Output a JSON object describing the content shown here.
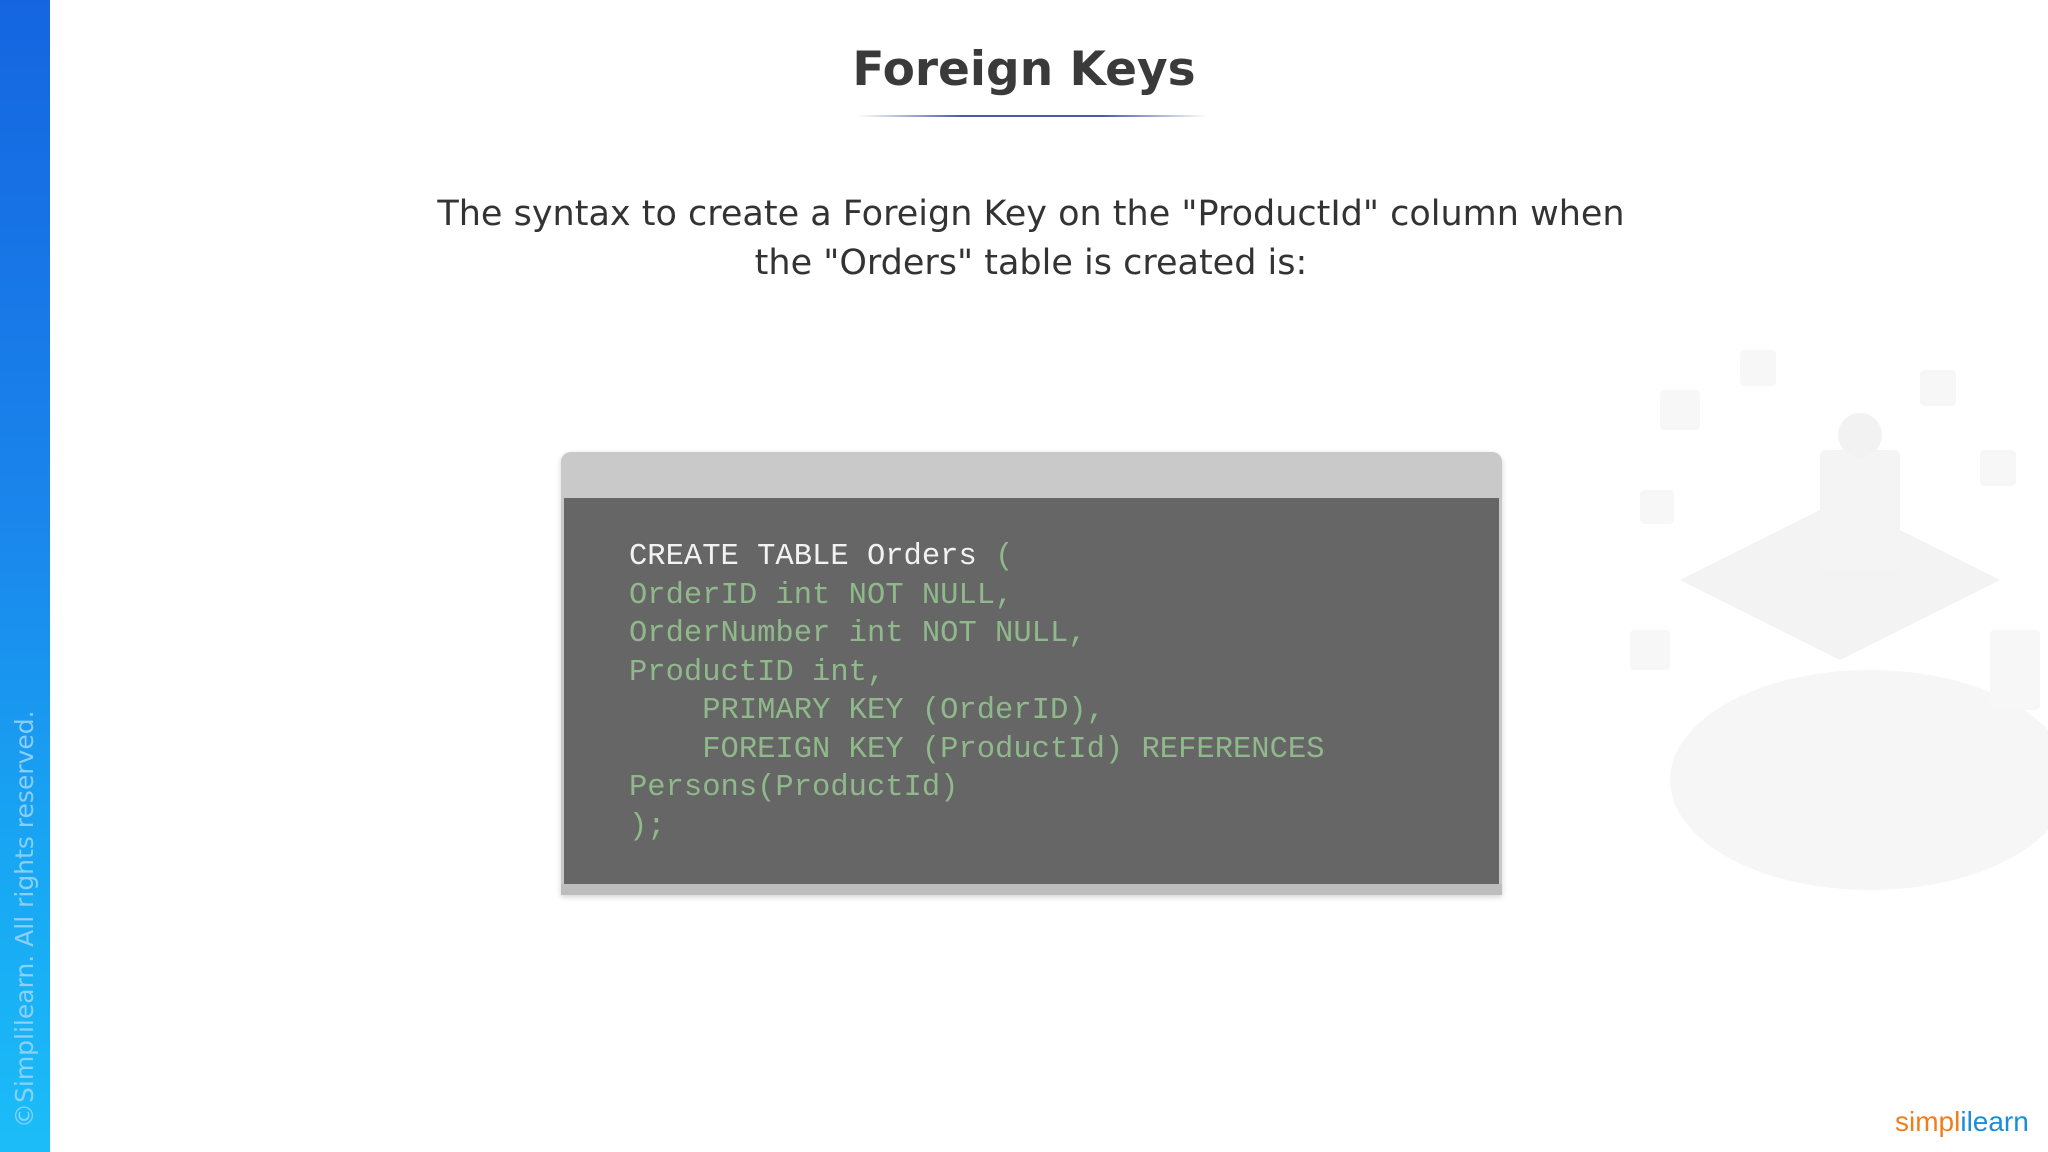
{
  "slide": {
    "title": "Foreign Keys",
    "intro": "The syntax to create a Foreign Key on the \"ProductId\" column when the \"Orders\" table is created is:"
  },
  "code": {
    "first_line_keyword": "CREATE TABLE Orders",
    "first_line_rest": " (",
    "lines": [
      "OrderID int NOT NULL,",
      "OrderNumber int NOT NULL,",
      "ProductID int,",
      "    PRIMARY KEY (OrderID),",
      "    FOREIGN KEY (ProductId) REFERENCES",
      "Persons(ProductId)",
      ");"
    ]
  },
  "footer": {
    "copyright": "©Simplilearn. All rights reserved.",
    "logo_part1": "simpl",
    "logo_part2": "ilearn"
  },
  "colors": {
    "side_band_top": "#1565e0",
    "side_band_bottom": "#1bbdf8",
    "code_background": "#666666",
    "code_keyword": "#f2f2f2",
    "code_text": "#8fb98a",
    "logo_orange": "#f07f1b",
    "logo_blue": "#1a8fd8"
  }
}
